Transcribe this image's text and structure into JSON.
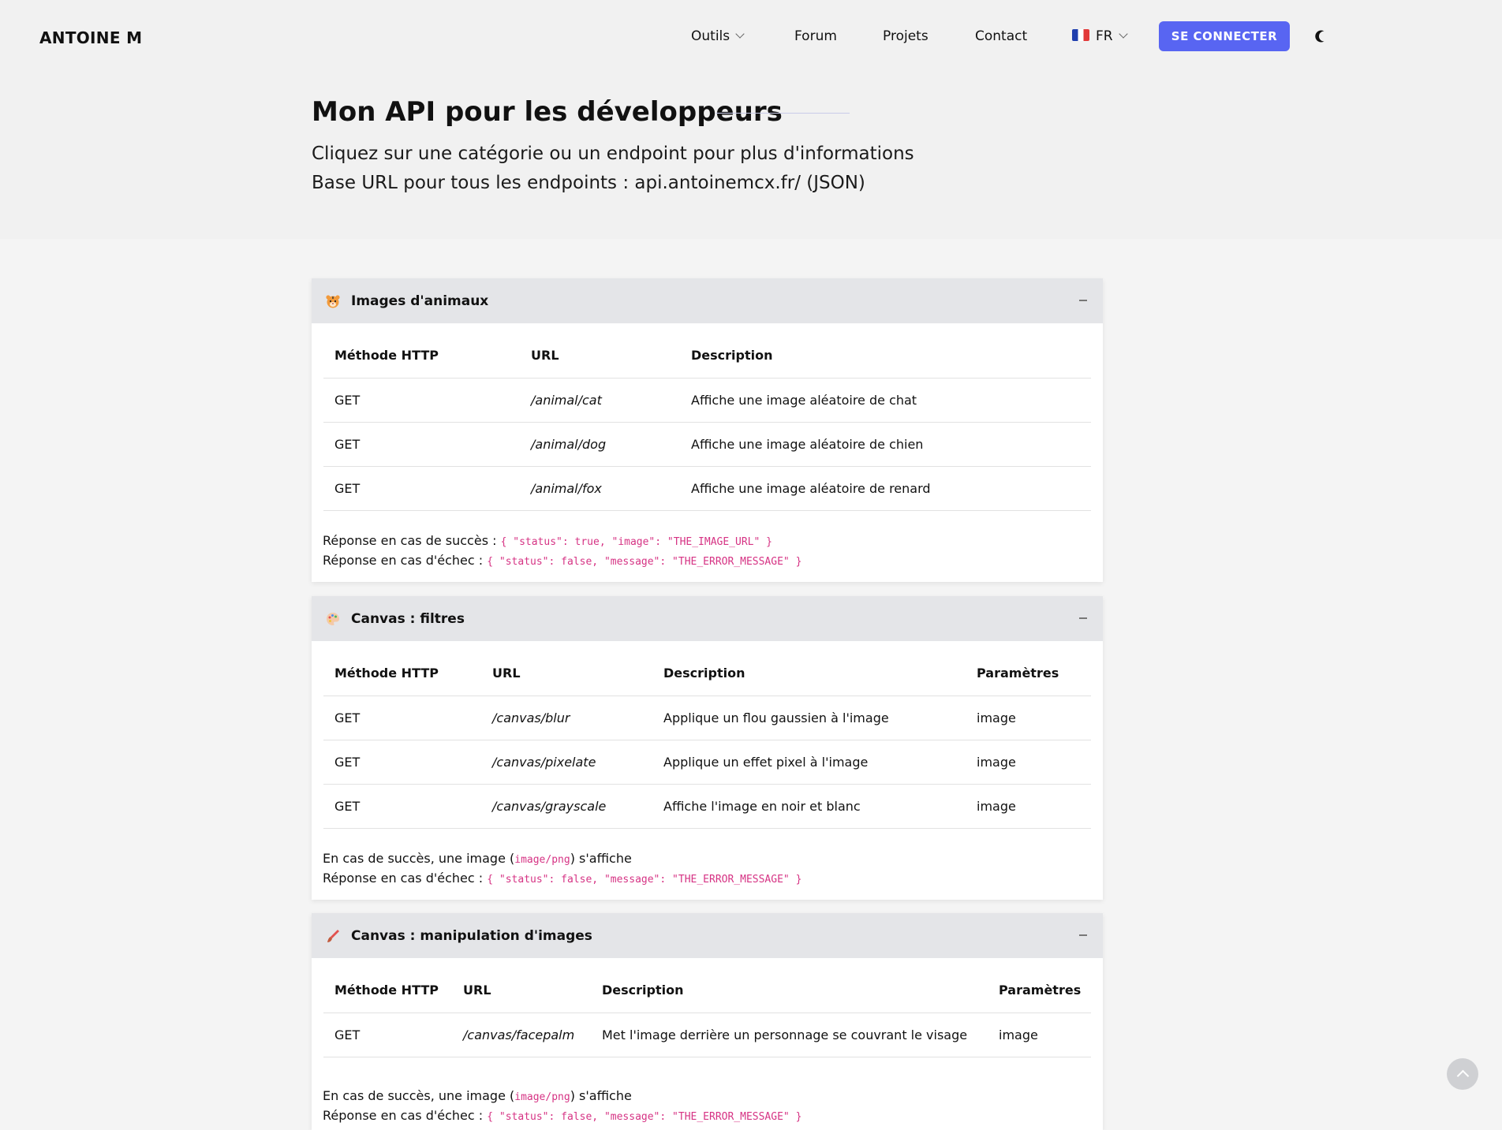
{
  "brand": "ANTOINE M",
  "nav": {
    "tools": "Outils",
    "forum": "Forum",
    "projects": "Projets",
    "contact": "Contact",
    "language": "FR",
    "login": "SE CONNECTER"
  },
  "hero": {
    "title": "Mon API pour les développeurs",
    "subtitle1": "Cliquez sur une catégorie ou un endpoint pour plus d'informations",
    "subtitle2": "Base URL pour tous les endpoints : api.antoinemcx.fr/ (JSON)"
  },
  "sections": [
    {
      "icon": "tiger-face-icon",
      "title": "Images d'animaux",
      "headers": [
        "Méthode HTTP",
        "URL",
        "Description"
      ],
      "rows": [
        {
          "method": "GET",
          "url": "/animal/cat",
          "description": "Affiche une image aléatoire de chat"
        },
        {
          "method": "GET",
          "url": "/animal/dog",
          "description": "Affiche une image aléatoire de chien"
        },
        {
          "method": "GET",
          "url": "/animal/fox",
          "description": "Affiche une image aléatoire de renard"
        }
      ],
      "success_label": "Réponse en cas de succès :",
      "success_code": "{ \"status\": true, \"image\": \"THE_IMAGE_URL\" }",
      "error_label": "Réponse en cas d'échec :",
      "error_code": "{ \"status\": false, \"message\": \"THE_ERROR_MESSAGE\" }"
    },
    {
      "icon": "palette-icon",
      "title": "Canvas : filtres",
      "headers": [
        "Méthode HTTP",
        "URL",
        "Description",
        "Paramètres"
      ],
      "rows": [
        {
          "method": "GET",
          "url": "/canvas/blur",
          "description": "Applique un flou gaussien à l'image",
          "params": "image"
        },
        {
          "method": "GET",
          "url": "/canvas/pixelate",
          "description": "Applique un effet pixel à l'image",
          "params": "image"
        },
        {
          "method": "GET",
          "url": "/canvas/grayscale",
          "description": "Affiche l'image en noir et blanc",
          "params": "image"
        }
      ],
      "success_pre": "En cas de succès, une image (",
      "success_code": "image/png",
      "success_post": ") s'affiche",
      "error_label": "Réponse en cas d'échec :",
      "error_code": "{ \"status\": false, \"message\": \"THE_ERROR_MESSAGE\" }"
    },
    {
      "icon": "paintbrush-icon",
      "title": "Canvas : manipulation d'images",
      "headers": [
        "Méthode HTTP",
        "URL",
        "Description",
        "Paramètres"
      ],
      "rows": [
        {
          "method": "GET",
          "url": "/canvas/facepalm",
          "description": "Met l'image derrière un personnage se couvrant le visage",
          "params": "image"
        }
      ],
      "success_pre": "En cas de succès, une image (",
      "success_code": "image/png",
      "success_post": ") s'affiche",
      "error_label": "Réponse en cas d'échec :",
      "error_code": "{ \"status\": false, \"message\": \"THE_ERROR_MESSAGE\" }"
    }
  ],
  "colors": {
    "accent": "#5865f2",
    "code": "#d63384",
    "card_header": "#e4e5e8",
    "page_bg": "#f4f4f4"
  }
}
